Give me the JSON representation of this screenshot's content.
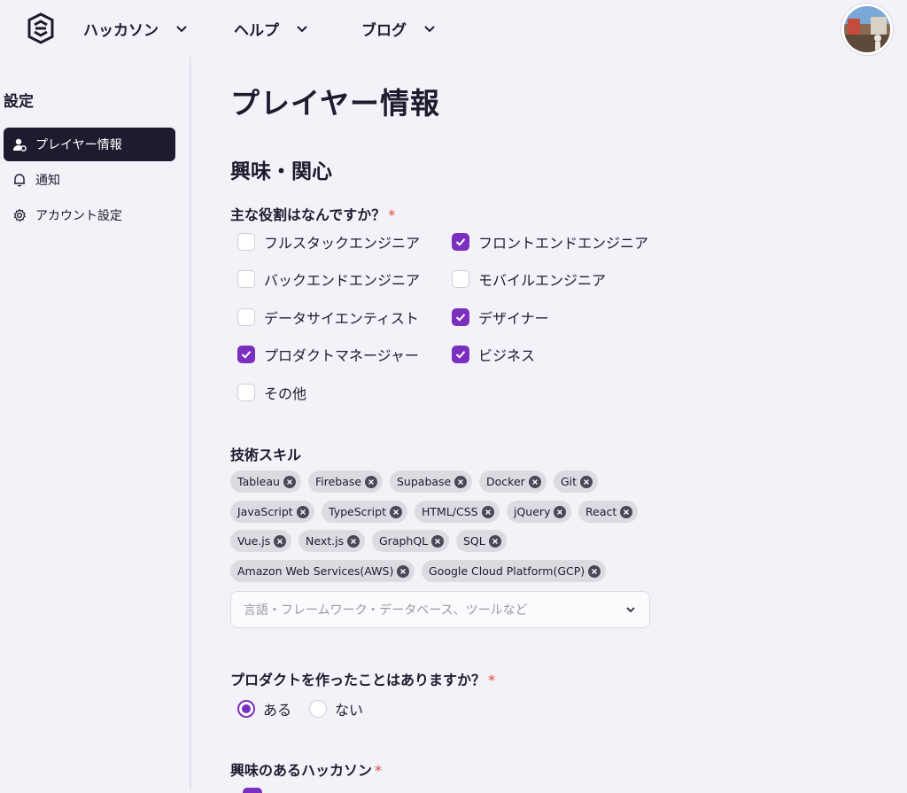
{
  "header": {
    "nav": [
      {
        "label": "ハッカソン"
      },
      {
        "label": "ヘルプ"
      },
      {
        "label": "ブログ"
      }
    ]
  },
  "sidebar": {
    "title": "設定",
    "items": [
      {
        "label": "プレイヤー情報",
        "icon": "user-gear-icon",
        "active": true
      },
      {
        "label": "通知",
        "icon": "bell-icon",
        "active": false
      },
      {
        "label": "アカウント設定",
        "icon": "gear-icon",
        "active": false
      }
    ]
  },
  "main": {
    "title": "プレイヤー情報",
    "section": "興味・関心",
    "roles": {
      "label": "主な役割はなんですか？",
      "required": "*",
      "options": [
        {
          "label": "フルスタックエンジニア",
          "checked": false
        },
        {
          "label": "フロントエンドエンジニア",
          "checked": true
        },
        {
          "label": "バックエンドエンジニア",
          "checked": false
        },
        {
          "label": "モバイルエンジニア",
          "checked": false
        },
        {
          "label": "データサイエンティスト",
          "checked": false
        },
        {
          "label": "デザイナー",
          "checked": true
        },
        {
          "label": "プロダクトマネージャー",
          "checked": true
        },
        {
          "label": "ビジネス",
          "checked": true
        },
        {
          "label": "その他",
          "checked": false
        }
      ]
    },
    "skills": {
      "label": "技術スキル",
      "chips": [
        "Tableau",
        "Firebase",
        "Supabase",
        "Docker",
        "Git",
        "JavaScript",
        "TypeScript",
        "HTML/CSS",
        "jQuery",
        "React",
        "Vue.js",
        "Next.js",
        "GraphQL",
        "SQL",
        "Amazon Web Services(AWS)",
        "Google Cloud Platform(GCP)"
      ],
      "placeholder": "言語・フレームワーク・データベース、ツールなど"
    },
    "product": {
      "label": "プロダクトを作ったことはありますか？",
      "required": "*",
      "options": [
        {
          "label": "ある",
          "selected": true
        },
        {
          "label": "ない",
          "selected": false
        }
      ]
    },
    "hackathon": {
      "label": "興味のあるハッカソン",
      "required": "*"
    }
  },
  "colors": {
    "accent": "#7b2fbf",
    "dark": "#1f1a2e",
    "background": "#f4f2f9"
  }
}
